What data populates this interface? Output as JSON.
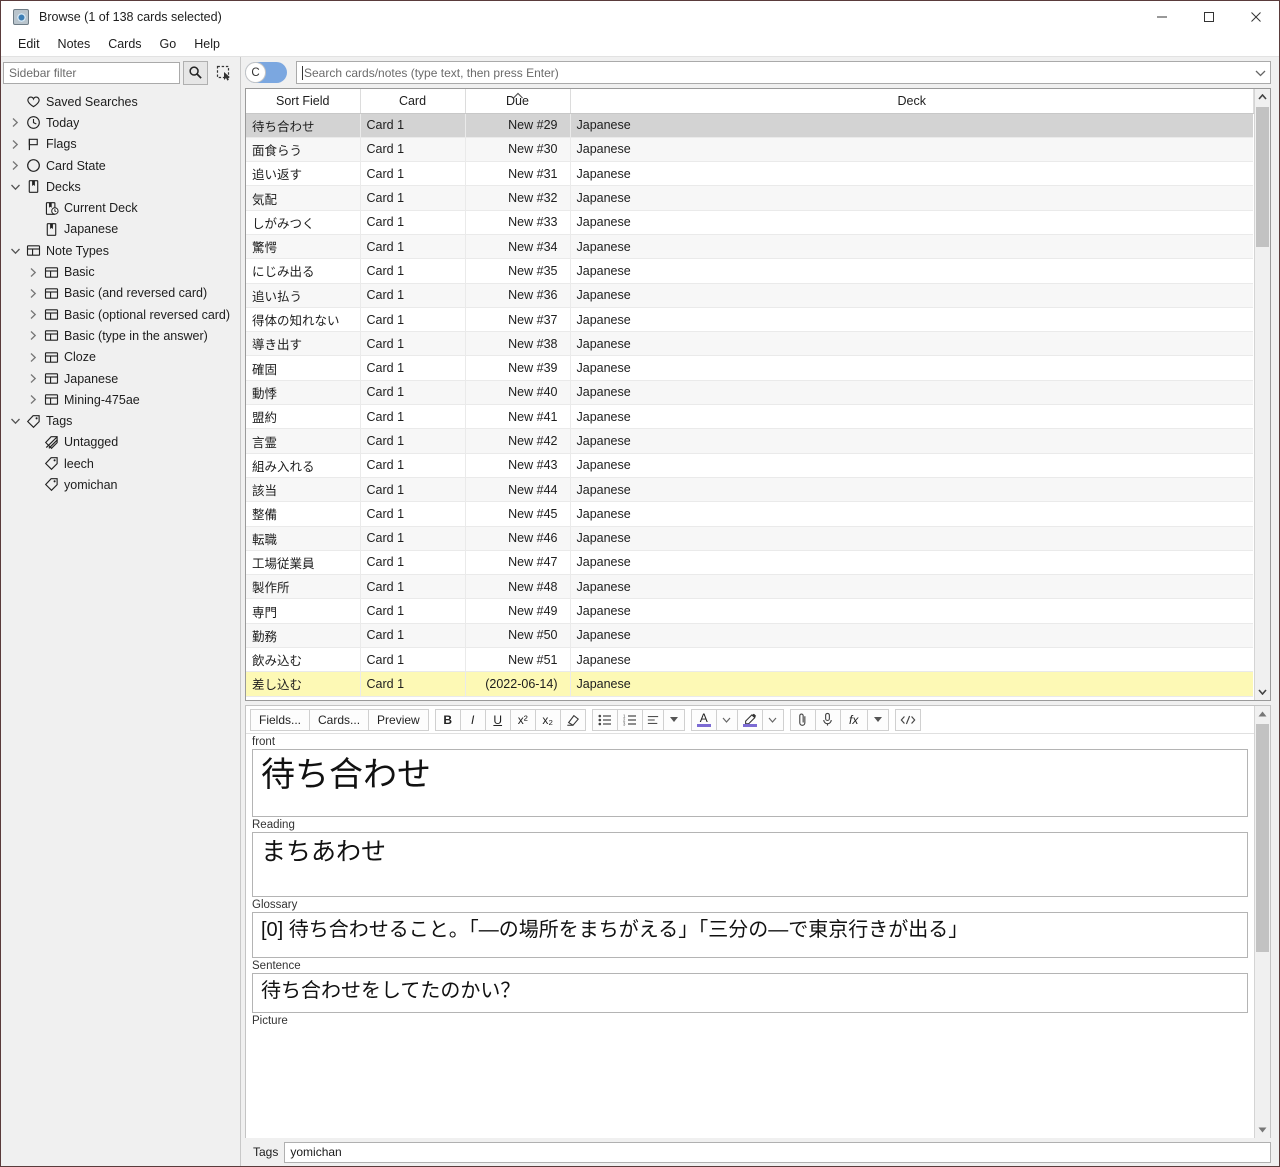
{
  "window": {
    "title": "Browse (1 of 138 cards selected)",
    "app_icon": "anki-card-icon",
    "minimize": "minimize-icon",
    "maximize": "maximize-icon",
    "close": "close-icon"
  },
  "menubar": {
    "items": [
      "Edit",
      "Notes",
      "Cards",
      "Go",
      "Help"
    ]
  },
  "sidebar": {
    "filter_placeholder": "Sidebar filter",
    "filter_value": "",
    "search_button_icon": "magnifier-icon",
    "select_button_icon": "marquee-select-icon",
    "items": [
      {
        "label": "Saved Searches",
        "icon": "heart-icon",
        "indent": 1,
        "twisty": "none"
      },
      {
        "label": "Today",
        "icon": "clock-icon",
        "indent": 1,
        "twisty": "collapsed"
      },
      {
        "label": "Flags",
        "icon": "flag-icon",
        "indent": 1,
        "twisty": "collapsed"
      },
      {
        "label": "Card State",
        "icon": "circle-icon",
        "indent": 1,
        "twisty": "collapsed"
      },
      {
        "label": "Decks",
        "icon": "deck-icon",
        "indent": 1,
        "twisty": "expanded"
      },
      {
        "label": "Current Deck",
        "icon": "current-deck-icon",
        "indent": 2,
        "twisty": "none"
      },
      {
        "label": "Japanese",
        "icon": "deck-icon",
        "indent": 2,
        "twisty": "none"
      },
      {
        "label": "Note Types",
        "icon": "notetype-icon",
        "indent": 1,
        "twisty": "expanded"
      },
      {
        "label": "Basic",
        "icon": "notetype-icon",
        "indent": 2,
        "twisty": "collapsed"
      },
      {
        "label": "Basic (and reversed card)",
        "icon": "notetype-icon",
        "indent": 2,
        "twisty": "collapsed"
      },
      {
        "label": "Basic (optional reversed card)",
        "icon": "notetype-icon",
        "indent": 2,
        "twisty": "collapsed"
      },
      {
        "label": "Basic (type in the answer)",
        "icon": "notetype-icon",
        "indent": 2,
        "twisty": "collapsed"
      },
      {
        "label": "Cloze",
        "icon": "notetype-icon",
        "indent": 2,
        "twisty": "collapsed"
      },
      {
        "label": "Japanese",
        "icon": "notetype-icon",
        "indent": 2,
        "twisty": "collapsed"
      },
      {
        "label": "Mining-475ae",
        "icon": "notetype-icon",
        "indent": 2,
        "twisty": "collapsed"
      },
      {
        "label": "Tags",
        "icon": "tag-icon",
        "indent": 1,
        "twisty": "expanded"
      },
      {
        "label": "Untagged",
        "icon": "untagged-icon",
        "indent": 2,
        "twisty": "none"
      },
      {
        "label": "leech",
        "icon": "tag-icon",
        "indent": 2,
        "twisty": "none"
      },
      {
        "label": "yomichan",
        "icon": "tag-icon",
        "indent": 2,
        "twisty": "none"
      }
    ]
  },
  "search": {
    "toggle_label": "C",
    "toggle_on": true,
    "placeholder": "Search cards/notes (type text, then press Enter)",
    "value": "",
    "dropdown_icon": "chevron-down-icon"
  },
  "table": {
    "columns": [
      "Sort Field",
      "Card",
      "Due",
      "Deck"
    ],
    "sort_column": "Due",
    "sort_direction": "ascending",
    "rows": [
      {
        "sort_field": "待ち合わせ",
        "card": "Card 1",
        "due": "New #29",
        "deck": "Japanese",
        "state": "selected"
      },
      {
        "sort_field": "面食らう",
        "card": "Card 1",
        "due": "New #30",
        "deck": "Japanese",
        "state": "alt"
      },
      {
        "sort_field": "追い返す",
        "card": "Card 1",
        "due": "New #31",
        "deck": "Japanese",
        "state": "normal"
      },
      {
        "sort_field": "気配",
        "card": "Card 1",
        "due": "New #32",
        "deck": "Japanese",
        "state": "alt"
      },
      {
        "sort_field": "しがみつく",
        "card": "Card 1",
        "due": "New #33",
        "deck": "Japanese",
        "state": "normal"
      },
      {
        "sort_field": "驚愕",
        "card": "Card 1",
        "due": "New #34",
        "deck": "Japanese",
        "state": "alt"
      },
      {
        "sort_field": "にじみ出る",
        "card": "Card 1",
        "due": "New #35",
        "deck": "Japanese",
        "state": "normal"
      },
      {
        "sort_field": "追い払う",
        "card": "Card 1",
        "due": "New #36",
        "deck": "Japanese",
        "state": "alt"
      },
      {
        "sort_field": "得体の知れない",
        "card": "Card 1",
        "due": "New #37",
        "deck": "Japanese",
        "state": "normal"
      },
      {
        "sort_field": "導き出す",
        "card": "Card 1",
        "due": "New #38",
        "deck": "Japanese",
        "state": "alt"
      },
      {
        "sort_field": "確固",
        "card": "Card 1",
        "due": "New #39",
        "deck": "Japanese",
        "state": "normal"
      },
      {
        "sort_field": "動悸",
        "card": "Card 1",
        "due": "New #40",
        "deck": "Japanese",
        "state": "alt"
      },
      {
        "sort_field": "盟約",
        "card": "Card 1",
        "due": "New #41",
        "deck": "Japanese",
        "state": "normal"
      },
      {
        "sort_field": "言霊",
        "card": "Card 1",
        "due": "New #42",
        "deck": "Japanese",
        "state": "alt"
      },
      {
        "sort_field": "組み入れる",
        "card": "Card 1",
        "due": "New #43",
        "deck": "Japanese",
        "state": "normal"
      },
      {
        "sort_field": "該当",
        "card": "Card 1",
        "due": "New #44",
        "deck": "Japanese",
        "state": "alt"
      },
      {
        "sort_field": "整備",
        "card": "Card 1",
        "due": "New #45",
        "deck": "Japanese",
        "state": "normal"
      },
      {
        "sort_field": "転職",
        "card": "Card 1",
        "due": "New #46",
        "deck": "Japanese",
        "state": "alt"
      },
      {
        "sort_field": "工場従業員",
        "card": "Card 1",
        "due": "New #47",
        "deck": "Japanese",
        "state": "normal"
      },
      {
        "sort_field": "製作所",
        "card": "Card 1",
        "due": "New #48",
        "deck": "Japanese",
        "state": "alt"
      },
      {
        "sort_field": "専門",
        "card": "Card 1",
        "due": "New #49",
        "deck": "Japanese",
        "state": "normal"
      },
      {
        "sort_field": "勤務",
        "card": "Card 1",
        "due": "New #50",
        "deck": "Japanese",
        "state": "alt"
      },
      {
        "sort_field": "飲み込む",
        "card": "Card 1",
        "due": "New #51",
        "deck": "Japanese",
        "state": "normal"
      },
      {
        "sort_field": "差し込む",
        "card": "Card 1",
        "due": "(2022-06-14)",
        "deck": "Japanese",
        "state": "marked"
      }
    ]
  },
  "editor": {
    "toolbar": {
      "fields_label": "Fields...",
      "cards_label": "Cards...",
      "preview_label": "Preview",
      "bold_label": "B",
      "italic_label": "I",
      "underline_label": "U",
      "superscript_label": "x²",
      "subscript_label": "x₂",
      "remove_format_icon": "eraser-icon",
      "bullet_list_icon": "bullet-list-icon",
      "numbered_list_icon": "numbered-list-icon",
      "align_icon": "align-icon",
      "align_caret_icon": "caret-down-icon",
      "text_color_label": "A",
      "text_color_caret_icon": "caret-down-icon",
      "highlight_icon": "highlighter-icon",
      "highlight_caret_icon": "caret-down-icon",
      "attach_icon": "paperclip-icon",
      "record_icon": "microphone-icon",
      "mathjax_label": "fx",
      "mathjax_caret_icon": "caret-down-icon",
      "html_editor_icon": "code-icon",
      "accent_color": "#7c6bd4"
    },
    "fields": [
      {
        "name": "front",
        "value": "待ち合わせ",
        "size": "lg"
      },
      {
        "name": "Reading",
        "value": "まちあわせ",
        "size": "md"
      },
      {
        "name": "Glossary",
        "value": "[0] 待ち合わせること。「—の場所をまちがえる」「三分の—で東京行きが出る」",
        "size": "sm"
      },
      {
        "name": "Sentence",
        "value": "待ち合わせをしてたのかい？",
        "size": "sm"
      },
      {
        "name": "Picture",
        "value": "",
        "size": "sm"
      }
    ],
    "tags_label": "Tags",
    "tags_value": "yomichan"
  }
}
